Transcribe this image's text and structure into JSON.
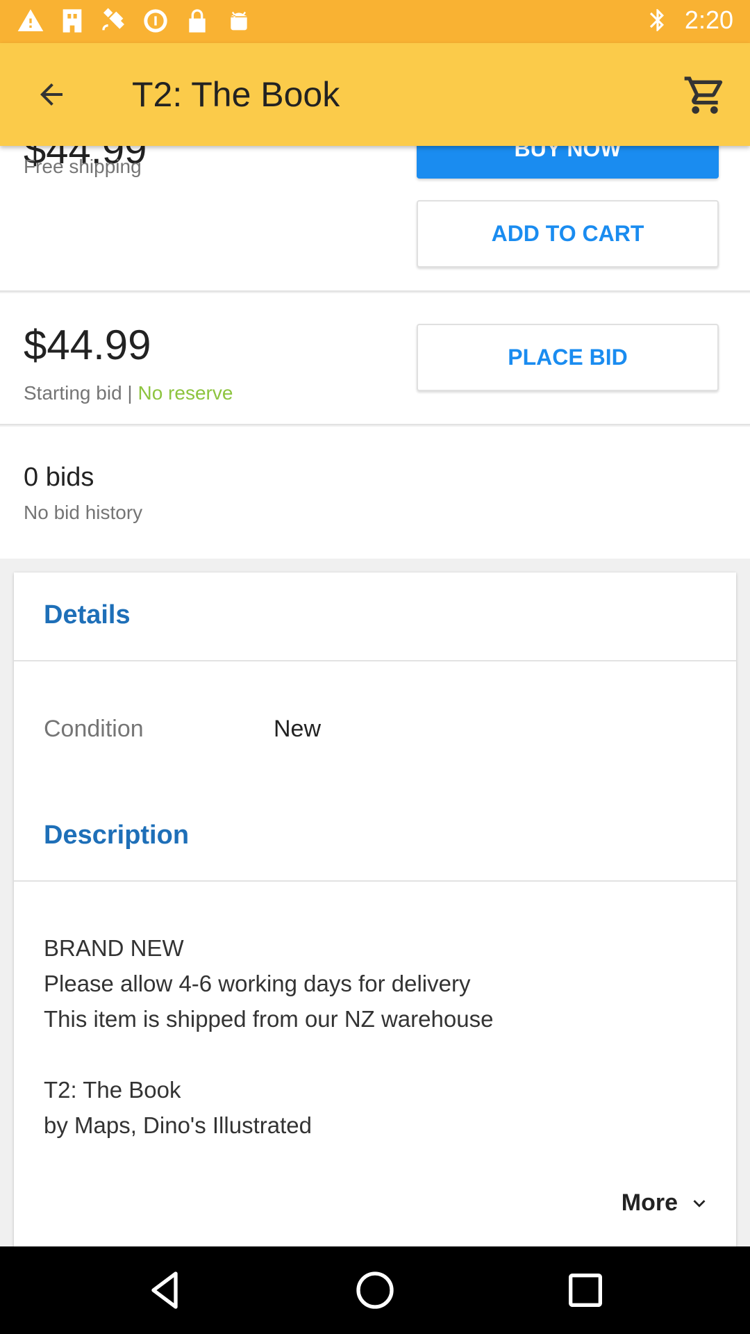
{
  "status_bar": {
    "time": "2:20",
    "left_icons": [
      "warning-icon",
      "fake-gps-icon",
      "satellite-icon",
      "sync-icon",
      "lock-icon",
      "android-icon"
    ],
    "right_icons": [
      "bluetooth-icon"
    ]
  },
  "app_bar": {
    "title": "T2: The Book",
    "back_icon": "arrow-back-icon",
    "cart_icon": "shopping-cart-icon",
    "background": "#fbcb4a"
  },
  "buy_section": {
    "price_partial": "$44.99",
    "shipping": "Free shipping",
    "buy_now_label": "BUY NOW",
    "add_to_cart_label": "ADD TO CART"
  },
  "bid_section": {
    "price": "$44.99",
    "starting_bid": "Starting bid | ",
    "reserve": "No reserve",
    "place_bid_label": "PLACE BID"
  },
  "bids_section": {
    "count": "0 bids",
    "history": "No bid history"
  },
  "details": {
    "heading": "Details",
    "condition_label": "Condition",
    "condition_value": "New",
    "description_heading": "Description",
    "description_lines": [
      "BRAND NEW",
      "Please allow 4-6 working days for delivery",
      "This item is shipped from our NZ warehouse",
      "",
      "T2: The Book",
      "by Maps, Dino's Illustrated"
    ],
    "more_label": "More"
  },
  "colors": {
    "accent_blue": "#1a8cf0",
    "heading_blue": "#1e6fb8",
    "reserve_green": "#8dc43f",
    "status_bar": "#f9b233"
  }
}
